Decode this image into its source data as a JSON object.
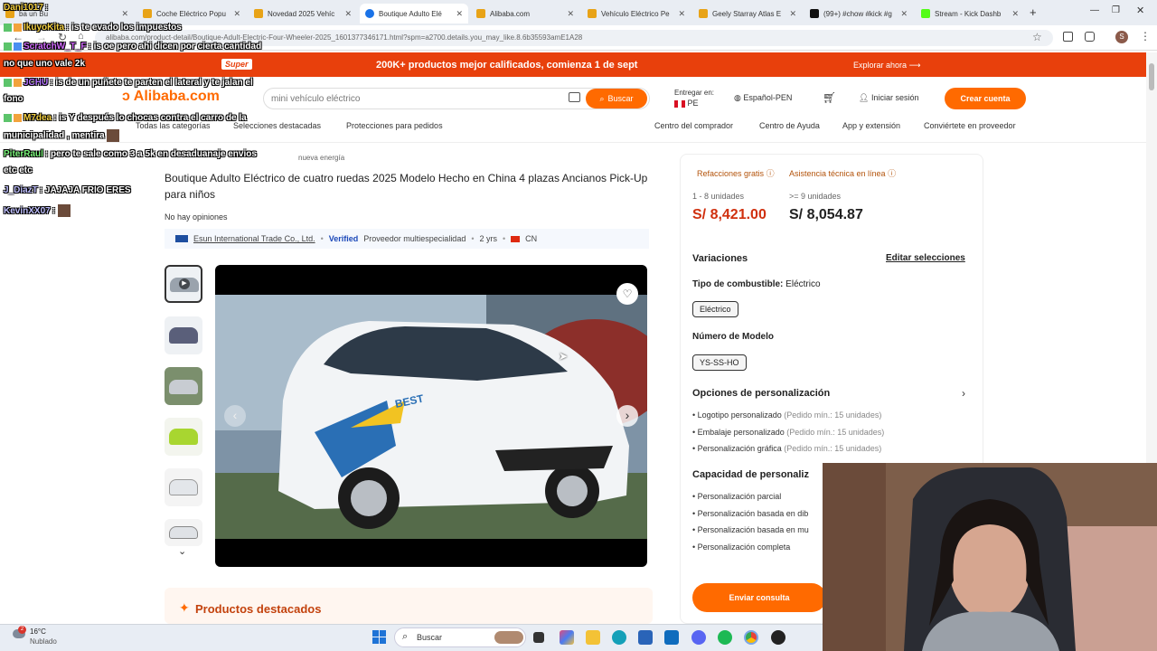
{
  "browser": {
    "tabs": [
      {
        "label": "ba un Bu",
        "color": "#e8a317"
      },
      {
        "label": "Coche Eléctrico Popu",
        "color": "#e8a317"
      },
      {
        "label": "Novedad 2025 Vehíc",
        "color": "#e8a317"
      },
      {
        "label": "Boutique Adulto Elé",
        "color": "#1a73e8"
      },
      {
        "label": "Alibaba.com",
        "color": "#e8a317"
      },
      {
        "label": "Vehículo Eléctrico Pe",
        "color": "#e8a317"
      },
      {
        "label": "Geely Starray Atlas E",
        "color": "#e8a317"
      },
      {
        "label": "(99+) #chow #kick #g",
        "color": "#111111"
      },
      {
        "label": "Stream - Kick Dashb",
        "color": "#53fc18"
      }
    ],
    "new_tab": "+",
    "url": "alibaba.com/product-detail/Boutique-Adult-Electric-Four-Wheeler-2025_1601377346171.html?spm=a2700.details.you_may_like.8.6b35593amE1A28",
    "profile_initial": "S"
  },
  "promo": {
    "super_label": "Super",
    "message": "200K+ productos mejor calificados, comienza 1 de sept",
    "explore": "Explorar ahora"
  },
  "header": {
    "logo": "Alibaba.com",
    "search_placeholder": "mini vehículo eléctrico",
    "search_button": "Buscar",
    "deliver_to": "Entregar en:",
    "country": "PE",
    "language": "Español-PEN",
    "login": "Iniciar sesión",
    "register": "Crear cuenta"
  },
  "nav": {
    "all_categories": "Todas las categorías",
    "featured": "Selecciones destacadas",
    "protections": "Protecciones para pedidos",
    "buyer_center": "Centro del comprador",
    "help": "Centro de Ayuda",
    "app": "App y extensión",
    "become_supplier": "Conviértete en proveedor"
  },
  "product": {
    "breadcrumb": "nueva energía",
    "title": "Boutique Adulto Eléctrico de cuatro ruedas 2025 Modelo Hecho en China 4 plazas Ancianos Pick-Up para niños",
    "reviews": "No hay opiniones",
    "supplier": "Esun International Trade Co., Ltd.",
    "verified": "Verified",
    "supplier_type": "Proveedor multiespecialidad",
    "years": "2 yrs",
    "country": "CN",
    "car_plate_text": "BEST"
  },
  "panel": {
    "free_returns": "Refacciones gratis",
    "tech_support": "Asistencia técnica en línea",
    "tier1_qty": "1 - 8 unidades",
    "tier1_price": "S/ 8,421.00",
    "tier2_qty": ">= 9 unidades",
    "tier2_price": "S/ 8,054.87",
    "variations": "Variaciones",
    "edit": "Editar selecciones",
    "fuel_label": "Tipo de combustible:",
    "fuel_value": "Eléctrico",
    "fuel_chip": "Eléctrico",
    "model_label": "Número de Modelo",
    "model_chip": "YS-SS-HO",
    "custom_title": "Opciones de personalización",
    "custom_items": [
      {
        "name": "Logotipo personalizado",
        "note": "(Pedido mín.: 15 unidades)"
      },
      {
        "name": "Embalaje personalizado",
        "note": "(Pedido mín.: 15 unidades)"
      },
      {
        "name": "Personalización gráfica",
        "note": "(Pedido mín.: 15 unidades)"
      }
    ],
    "capacity_title": "Capacidad de personaliz",
    "capacity_items": [
      "Personalización parcial",
      "Personalización basada en dib",
      "Personalización basada en mu",
      "Personalización completa"
    ],
    "inquiry": "Enviar consulta"
  },
  "featured": {
    "title": "Productos destacados"
  },
  "taskbar": {
    "temp": "16°C",
    "weather": "Nublado",
    "search": "Buscar",
    "badge": "2"
  },
  "chat": [
    {
      "user": "Dani1017",
      "text": ":",
      "color": "#f5d142"
    },
    {
      "user": "IkuyoKita",
      "text": ": is te evado los impuestos",
      "color": "#f5d142"
    },
    {
      "user": "ScratchW_T_F",
      "text": ": is oe pero ahi dicen por cierta cantidad",
      "color": "#d46cff"
    },
    {
      "user": "",
      "text": "no que uno vale 2k",
      "color": "#ffffff"
    },
    {
      "user": "JCHU",
      "text": ": is de un puñete te parten el lateral y te jalan el",
      "color": "#b574ff"
    },
    {
      "user": "",
      "text": "fono",
      "color": "#ffffff"
    },
    {
      "user": "M7dea",
      "text": ": is Y después lo chocas contra el carro de la",
      "color": "#f5d142"
    },
    {
      "user": "",
      "text": "municipalidad , mentira",
      "color": "#ffffff"
    },
    {
      "user": "PiterRaul",
      "text": ": pero te sale como 3 a 5k en desaduanaje envios",
      "color": "#7cf57c"
    },
    {
      "user": "",
      "text": "etc etc",
      "color": "#ffffff"
    },
    {
      "user": "J_DiazT",
      "text": ": JAJAJA FRIO ERES",
      "color": "#c0c0ff"
    },
    {
      "user": "KevinXX07",
      "text": ":",
      "color": "#c0c0ff"
    }
  ]
}
